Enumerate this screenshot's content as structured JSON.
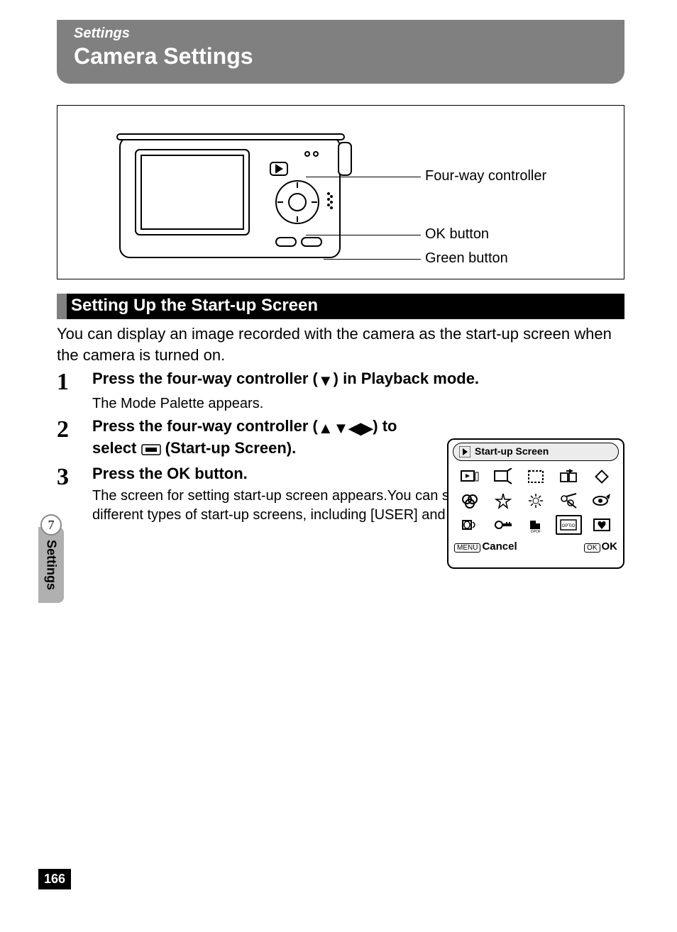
{
  "header": {
    "small": "Settings",
    "big": "Camera Settings"
  },
  "diagram": {
    "labels": {
      "fourway": "Four-way controller",
      "ok": "OK button",
      "green": "Green button"
    }
  },
  "section_title": "Setting Up the Start-up Screen",
  "intro": "You can display an image recorded with the camera as the start-up screen when the camera is turned on.",
  "steps": [
    {
      "num": "1",
      "head_pre": "Press the four-way controller (",
      "head_post": ") in Playback mode.",
      "sub": "The Mode Palette appears."
    },
    {
      "num": "2",
      "head_a": "Press the four-way controller (",
      "head_b": ") to select ",
      "head_c": " (Start-up Screen)."
    },
    {
      "num": "3",
      "head": "Press the OK button.",
      "sub": "The screen for setting start-up screen appears.You can select from five different types of start-up screens, including [USER] and [Off]."
    }
  ],
  "palette": {
    "title": "Start-up Screen",
    "menu_btn": "MENU",
    "cancel": "Cancel",
    "ok_btn": "OK",
    "ok_label": "OK",
    "optio": "OPTIO",
    "dpof": "DPOF"
  },
  "side": {
    "chapter": "7",
    "label": "Settings"
  },
  "page_number": "166"
}
